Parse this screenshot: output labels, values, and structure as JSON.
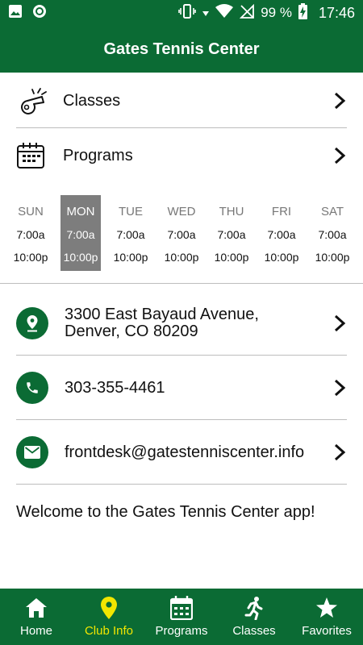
{
  "status_bar": {
    "battery": "99 %",
    "time": "17:46"
  },
  "app_bar": {
    "title": "Gates Tennis Center"
  },
  "menu": [
    {
      "label": "Classes",
      "icon": "whistle-icon"
    },
    {
      "label": "Programs",
      "icon": "calendar-icon"
    }
  ],
  "hours": [
    {
      "day": "SUN",
      "open": "7:00a",
      "close": "10:00p",
      "selected": false
    },
    {
      "day": "MON",
      "open": "7:00a",
      "close": "10:00p",
      "selected": true
    },
    {
      "day": "TUE",
      "open": "7:00a",
      "close": "10:00p",
      "selected": false
    },
    {
      "day": "WED",
      "open": "7:00a",
      "close": "10:00p",
      "selected": false
    },
    {
      "day": "THU",
      "open": "7:00a",
      "close": "10:00p",
      "selected": false
    },
    {
      "day": "FRI",
      "open": "7:00a",
      "close": "10:00p",
      "selected": false
    },
    {
      "day": "SAT",
      "open": "7:00a",
      "close": "10:00p",
      "selected": false
    }
  ],
  "contact": {
    "address_line1": "3300 East Bayaud Avenue,",
    "address_line2": "Denver, CO 80209",
    "phone": "303-355-4461",
    "email": "frontdesk@gatestenniscenter.info"
  },
  "welcome": "Welcome to the Gates Tennis Center app!",
  "bottom_nav": [
    {
      "label": "Home",
      "icon": "home-icon",
      "active": false
    },
    {
      "label": "Club Info",
      "icon": "location-pin-icon",
      "active": true
    },
    {
      "label": "Programs",
      "icon": "calendar-icon",
      "active": false
    },
    {
      "label": "Classes",
      "icon": "running-person-icon",
      "active": false
    },
    {
      "label": "Favorites",
      "icon": "star-icon",
      "active": false
    }
  ],
  "colors": {
    "primary": "#0b6b34",
    "active_nav": "#f2e600",
    "selected_day": "#7d7d7d"
  }
}
